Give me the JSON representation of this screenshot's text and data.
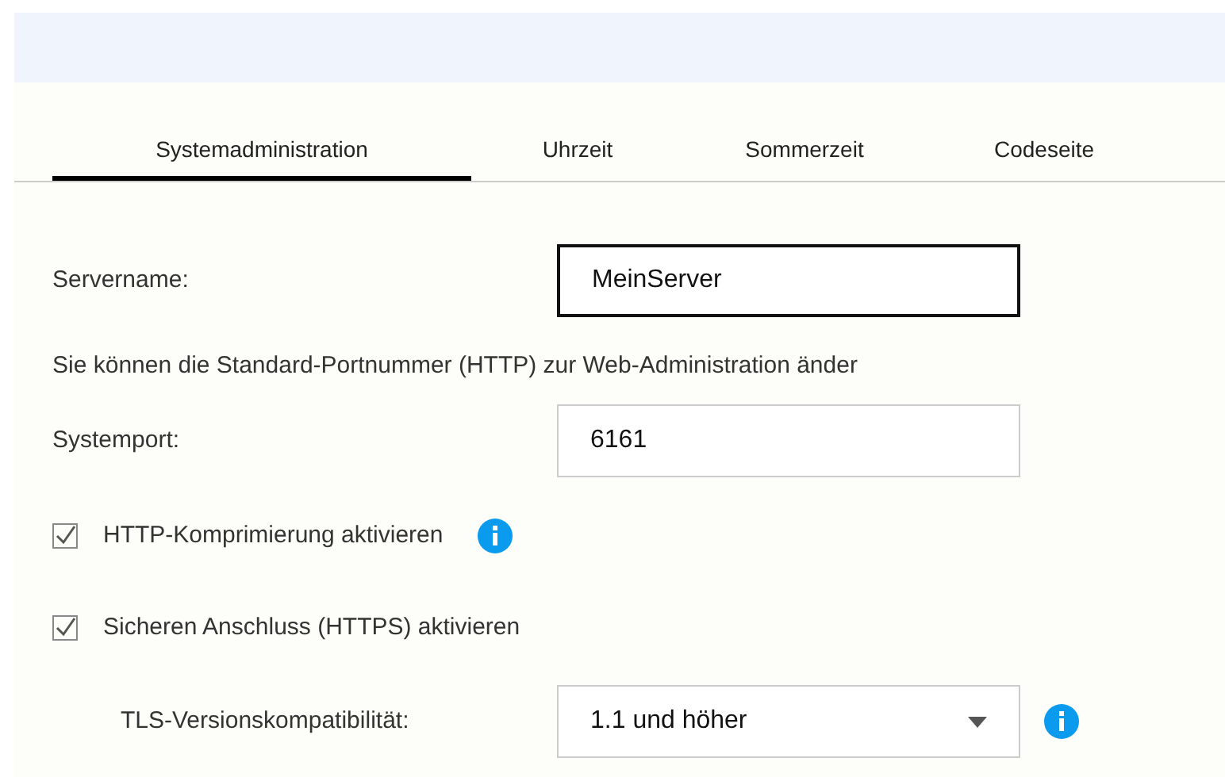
{
  "tabs": [
    {
      "label": "Systemadministration",
      "selected": true
    },
    {
      "label": "Uhrzeit",
      "selected": false
    },
    {
      "label": "Sommerzeit",
      "selected": false
    },
    {
      "label": "Codeseite",
      "selected": false
    }
  ],
  "server_name": {
    "label": "Servername:",
    "value": "MeinServer",
    "focused": true
  },
  "port_note": "Sie können die Standard-Portnummer (HTTP) zur Web-Administration änder",
  "system_port": {
    "label": "Systemport:",
    "value": "6161",
    "focused": false
  },
  "options": [
    {
      "label": "HTTP-Komprimierung aktivieren",
      "checked": true,
      "info": true
    },
    {
      "label": "Sicheren Anschluss (HTTPS) aktivieren",
      "checked": true,
      "info": false
    }
  ],
  "tls": {
    "label": "TLS-Versionskompatibilität:",
    "value": "1.1 und höher"
  }
}
